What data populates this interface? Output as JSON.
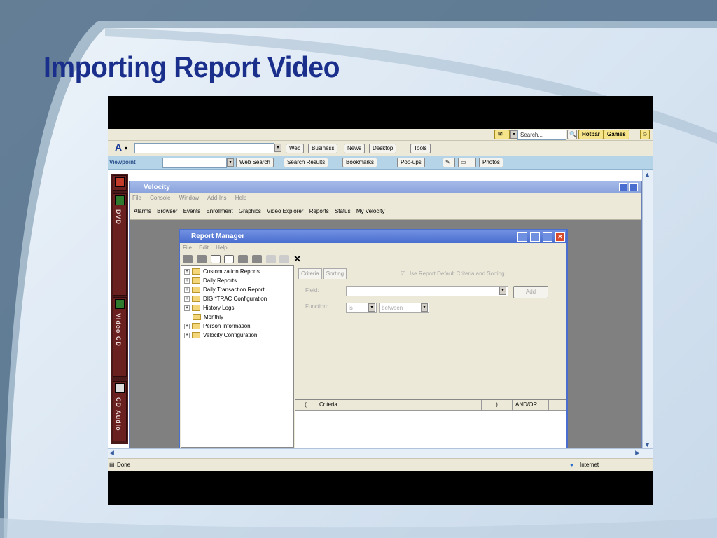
{
  "slide": {
    "title": "Importing Report Video"
  },
  "browser": {
    "toolbar1": {
      "search_placeholder": "Search...",
      "hotbar_label": "Hotbar",
      "games_label": "Games"
    },
    "toolbar2": {
      "logo": "A",
      "web": "Web",
      "business": "Business",
      "news": "News",
      "desktop": "Desktop",
      "tools": "Tools"
    },
    "toolbar3": {
      "viewpoint": "Viewpoint",
      "web_search": "Web Search",
      "search_results": "Search Results",
      "bookmarks": "Bookmarks",
      "popups": "Pop-ups",
      "photos": "Photos"
    },
    "status": {
      "done": "Done",
      "zone": "Internet"
    }
  },
  "media_bar": {
    "items": [
      {
        "label": "DVD"
      },
      {
        "label": "Video CD"
      },
      {
        "label": "CD Audio"
      }
    ]
  },
  "velocity": {
    "title": "Velocity",
    "menu": [
      "File",
      "Console",
      "Window",
      "Add-Ins",
      "Help"
    ],
    "tools": [
      "Alarms",
      "Browser",
      "Events",
      "Enrollment",
      "Graphics",
      "Video Explorer",
      "Reports",
      "Status",
      "My Velocity"
    ]
  },
  "report_manager": {
    "title": "Report Manager",
    "menu": [
      "File",
      "Edit",
      "Help"
    ],
    "tree": [
      "Customization Reports",
      "Daily Reports",
      "Daily Transaction Report",
      "DIGI*TRAC Configuration",
      "History Logs",
      "Monthly",
      "Person Information",
      "Velocity Configuration"
    ],
    "tabs": [
      "Criteria",
      "Sorting"
    ],
    "use_default_label": "Use Report Default Criteria and Sorting",
    "field_label": "Field:",
    "function_label": "Function:",
    "function_op": "is",
    "function_value": "between",
    "add_button": "Add",
    "grid_headers": [
      "(",
      "Criteria",
      ")",
      "AND/OR"
    ]
  }
}
